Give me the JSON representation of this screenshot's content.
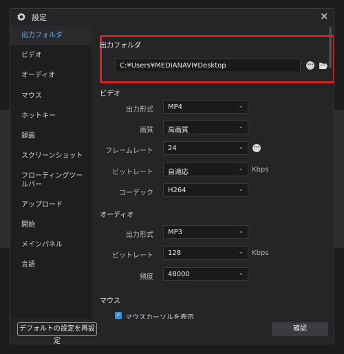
{
  "window": {
    "title": "設定"
  },
  "sidebar": {
    "items": [
      {
        "label": "出力フォルダ",
        "active": true
      },
      {
        "label": "ビデオ"
      },
      {
        "label": "オーディオ"
      },
      {
        "label": "マウス"
      },
      {
        "label": "ホットキー"
      },
      {
        "label": "録画"
      },
      {
        "label": "スクリーンショット"
      },
      {
        "label": "フローティングツールバー"
      },
      {
        "label": "アップロード"
      },
      {
        "label": "開始"
      },
      {
        "label": "メインパネル"
      },
      {
        "label": "言語"
      }
    ]
  },
  "output_folder": {
    "heading": "出力フォルダ",
    "path": "C:¥Users¥MEDIANAVI¥Desktop",
    "more_icon": "ellipsis-icon",
    "folder_icon": "folder-open-icon"
  },
  "video": {
    "heading": "ビデオ",
    "format_label": "出力形式",
    "format_value": "MP4",
    "quality_label": "画質",
    "quality_value": "高画質",
    "framerate_label": "フレームレート",
    "framerate_value": "24",
    "bitrate_label": "ビットレート",
    "bitrate_value": "自適応",
    "bitrate_unit": "Kbps",
    "codec_label": "コーデック",
    "codec_value": "H264"
  },
  "audio": {
    "heading": "オーディオ",
    "format_label": "出力形式",
    "format_value": "MP3",
    "bitrate_label": "ビットレート",
    "bitrate_value": "128",
    "bitrate_unit": "Kbps",
    "frequency_label": "頻度",
    "frequency_value": "48000"
  },
  "mouse": {
    "heading": "マウス",
    "show_cursor_label": "マウスカーソルを表示",
    "show_cursor_checked": true
  },
  "footer": {
    "default_button": "デフォルトの設定を再設定",
    "ok_button": "確認"
  },
  "colors": {
    "accent": "#4fb3ff",
    "highlight": "#e02020",
    "checkbox": "#2f8fe6"
  }
}
